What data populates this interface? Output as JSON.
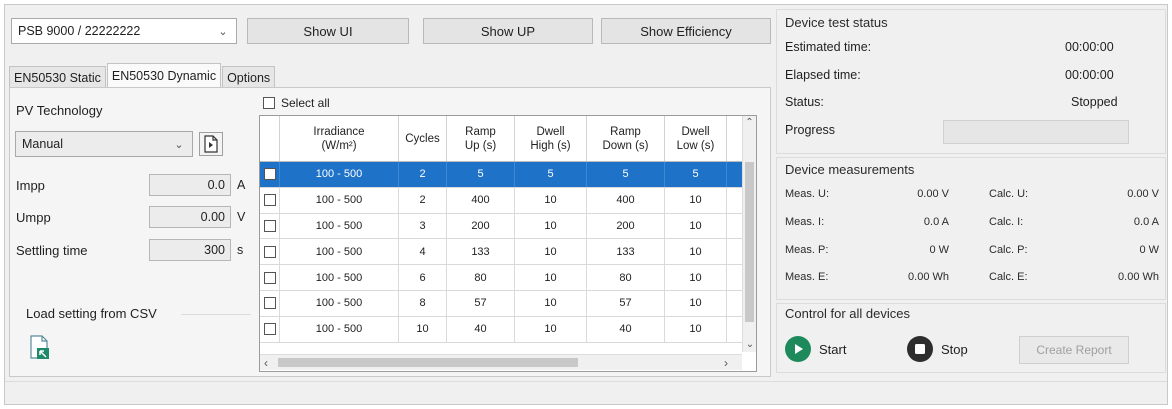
{
  "device_selector": {
    "value": "PSB 9000 / 22222222"
  },
  "buttons": {
    "show_ui": "Show UI",
    "show_up": "Show UP",
    "show_efficiency": "Show Efficiency"
  },
  "tabs": [
    {
      "label": "EN50530 Static",
      "active": false
    },
    {
      "label": "EN50530 Dynamic",
      "active": true
    },
    {
      "label": "Options",
      "active": false
    }
  ],
  "pv": {
    "title": "PV Technology",
    "technology_value": "Manual",
    "impp_label": "Impp",
    "impp_value": "0.0",
    "impp_unit": "A",
    "umpp_label": "Umpp",
    "umpp_value": "0.00",
    "umpp_unit": "V",
    "settling_label": "Settling time",
    "settling_value": "300",
    "settling_unit": "s",
    "load_csv_label": "Load setting from CSV"
  },
  "table": {
    "select_all_label": "Select all",
    "headers": [
      [
        "Irradiance",
        "(W/m²)"
      ],
      [
        "Cycles"
      ],
      [
        "Ramp",
        "Up (s)"
      ],
      [
        "Dwell",
        "High (s)"
      ],
      [
        "Ramp",
        "Down (s)"
      ],
      [
        "Dwell",
        "Low (s)"
      ]
    ],
    "rows": [
      {
        "selected": true,
        "cells": [
          "100 - 500",
          "2",
          "5",
          "5",
          "5",
          "5"
        ]
      },
      {
        "selected": false,
        "cells": [
          "100 - 500",
          "2",
          "400",
          "10",
          "400",
          "10"
        ]
      },
      {
        "selected": false,
        "cells": [
          "100 - 500",
          "3",
          "200",
          "10",
          "200",
          "10"
        ]
      },
      {
        "selected": false,
        "cells": [
          "100 - 500",
          "4",
          "133",
          "10",
          "133",
          "10"
        ]
      },
      {
        "selected": false,
        "cells": [
          "100 - 500",
          "6",
          "80",
          "10",
          "80",
          "10"
        ]
      },
      {
        "selected": false,
        "cells": [
          "100 - 500",
          "8",
          "57",
          "10",
          "57",
          "10"
        ]
      },
      {
        "selected": false,
        "cells": [
          "100 - 500",
          "10",
          "40",
          "10",
          "40",
          "10"
        ]
      }
    ]
  },
  "status": {
    "title": "Device test status",
    "estimated_label": "Estimated time:",
    "estimated_value": "00:00:00",
    "elapsed_label": "Elapsed time:",
    "elapsed_value": "00:00:00",
    "status_label": "Status:",
    "status_value": "Stopped",
    "progress_label": "Progress",
    "progress_fraction": 0
  },
  "measurements": {
    "title": "Device measurements",
    "rows": [
      {
        "meas_label": "Meas. U:",
        "meas_value": "0.00 V",
        "calc_label": "Calc. U:",
        "calc_value": "0.00 V"
      },
      {
        "meas_label": "Meas. I:",
        "meas_value": "0.0 A",
        "calc_label": "Calc. I:",
        "calc_value": "0.0 A"
      },
      {
        "meas_label": "Meas. P:",
        "meas_value": "0 W",
        "calc_label": "Calc. P:",
        "calc_value": "0 W"
      },
      {
        "meas_label": "Meas. E:",
        "meas_value": "0.00 Wh",
        "calc_label": "Calc. E:",
        "calc_value": "0.00 Wh"
      }
    ]
  },
  "control": {
    "title": "Control for all devices",
    "start_label": "Start",
    "stop_label": "Stop",
    "report_label": "Create Report"
  },
  "colors": {
    "selection": "#1e73c8",
    "start_icon": "#1e8a5c",
    "stop_icon": "#2d2d2d"
  }
}
